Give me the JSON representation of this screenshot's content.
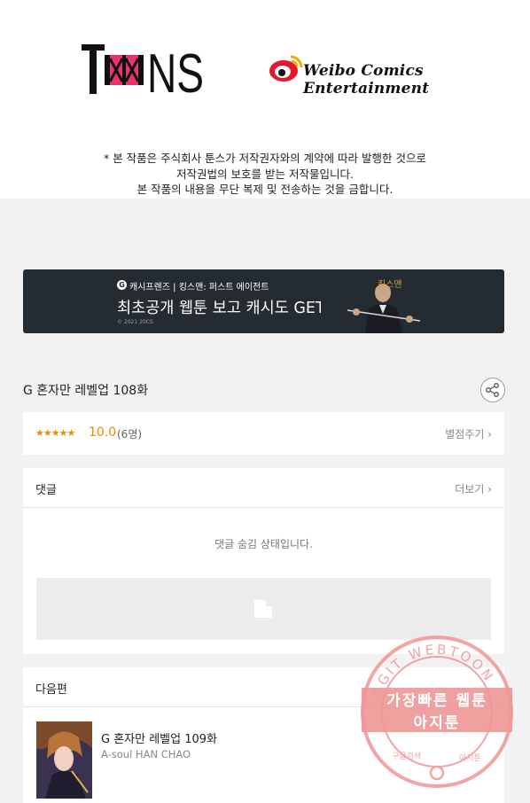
{
  "header": {
    "toons_logo_text": "TOONS",
    "weibo_logo_text": "Weibo Comics Entertainment",
    "notice_lines": [
      "* 본 작품은 주식회사 툰스가 저작권자와의 계약에 따라 발행한 것으로",
      "저작권법의 보호를 받는 저작물입니다.",
      "본 작품의 내용을 무단 복제 및 전송하는 것을 금합니다."
    ]
  },
  "banner": {
    "sub_text": "캐시프렌즈 | 킹스맨: 퍼스트 에이전트",
    "main_text": "최초공개 웹툰 보고 캐시도 GET!",
    "copyright": "© 2021 20CS",
    "tag": "킹스맨"
  },
  "episode": {
    "title": "G 혼자만 레벨업 108화"
  },
  "rating": {
    "stars": "★★★★★",
    "score": "10.0",
    "count": "(6명)",
    "rate_label": "별점주기 ›"
  },
  "comments": {
    "title": "댓글",
    "more_label": "더보기 ›",
    "hidden_message": "댓글 숨김 상태입니다."
  },
  "next": {
    "title": "다음편",
    "episode_title": "G 혼자만 레벨업 109화",
    "author": "A-soul HAN CHAO"
  },
  "watermark": {
    "ring_text": "AGIT WEBTOON",
    "line1": "가장빠른 웹툰",
    "line2": "아지툰",
    "bottom_left": "구글검색",
    "bottom_right": "아지툰"
  },
  "colors": {
    "rating_orange": "#f08c00",
    "banner_bg": "#252c31",
    "toons_pink": "#e8336f",
    "weibo_red": "#e6162d",
    "stamp_pink": "#f09696"
  }
}
